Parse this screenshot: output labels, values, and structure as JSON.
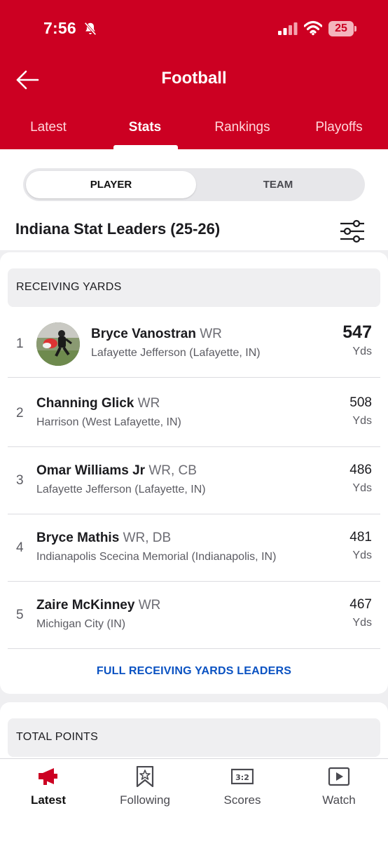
{
  "status_bar": {
    "time": "7:56",
    "battery": "25"
  },
  "header": {
    "title": "Football"
  },
  "tabs": [
    {
      "label": "Latest",
      "active": false
    },
    {
      "label": "Stats",
      "active": true
    },
    {
      "label": "Rankings",
      "active": false
    },
    {
      "label": "Playoffs",
      "active": false
    }
  ],
  "segment": {
    "player": "PLAYER",
    "team": "TEAM",
    "selected": "PLAYER"
  },
  "leaders_title": "Indiana Stat Leaders (25-26)",
  "receiving": {
    "category": "RECEIVING YARDS",
    "rows": [
      {
        "rank": "1",
        "name": "Bryce Vanostran",
        "position": "WR",
        "school": "Lafayette Jefferson (Lafayette, IN)",
        "value": "547",
        "unit": "Yds"
      },
      {
        "rank": "2",
        "name": "Channing Glick",
        "position": "WR",
        "school": "Harrison (West Lafayette, IN)",
        "value": "508",
        "unit": "Yds"
      },
      {
        "rank": "3",
        "name": "Omar Williams Jr",
        "position": "WR, CB",
        "school": "Lafayette Jefferson (Lafayette, IN)",
        "value": "486",
        "unit": "Yds"
      },
      {
        "rank": "4",
        "name": "Bryce Mathis",
        "position": "WR, DB",
        "school": "Indianapolis Scecina Memorial (Indianapolis, IN)",
        "value": "481",
        "unit": "Yds"
      },
      {
        "rank": "5",
        "name": "Zaire McKinney",
        "position": "WR",
        "school": "Michigan City (IN)",
        "value": "467",
        "unit": "Yds"
      }
    ],
    "full_link": "FULL RECEIVING YARDS LEADERS"
  },
  "total_points": {
    "category": "TOTAL POINTS"
  },
  "bottom_nav": [
    {
      "label": "Latest",
      "icon": "megaphone-icon",
      "active": true
    },
    {
      "label": "Following",
      "icon": "bookmark-star-icon",
      "active": false
    },
    {
      "label": "Scores",
      "icon": "scoreboard-icon",
      "active": false
    },
    {
      "label": "Watch",
      "icon": "play-icon",
      "active": false
    }
  ],
  "colors": {
    "brand_red": "#cc0022",
    "link_blue": "#0a52c2"
  }
}
